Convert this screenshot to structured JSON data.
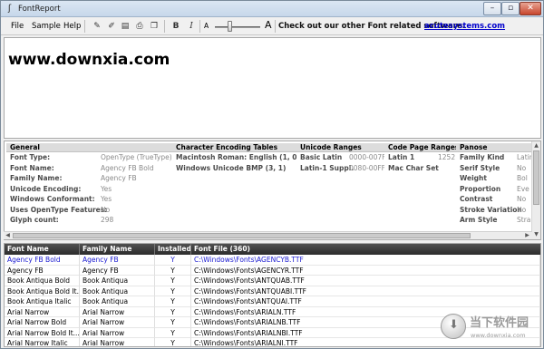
{
  "window": {
    "title": "FontReport",
    "icon": "font-app-icon"
  },
  "menu": [
    "File",
    "Sample",
    "Help"
  ],
  "toolbar": {
    "buttons": [
      {
        "name": "font-color-icon",
        "glyph": "✎"
      },
      {
        "name": "highlight-icon",
        "glyph": "✐"
      },
      {
        "name": "document-icon",
        "glyph": "▤"
      },
      {
        "name": "print-icon",
        "glyph": "⎙"
      },
      {
        "name": "copy-icon",
        "glyph": "❐"
      }
    ],
    "bold": "B",
    "italic": "I",
    "size_small": "A",
    "size_large": "A",
    "promo": "Check out our other Font related software:",
    "promo_link": "acutesystems.com"
  },
  "preview": {
    "text": "www.downxia.com"
  },
  "info": {
    "general": {
      "header": "General",
      "rows": [
        {
          "label": "Font Type:",
          "value": "OpenType (TrueType)"
        },
        {
          "label": "Font Name:",
          "value": "Agency FB Bold"
        },
        {
          "label": "Family Name:",
          "value": "Agency FB"
        },
        {
          "label": "Unicode Encoding:",
          "value": "Yes"
        },
        {
          "label": "Windows Conformant:",
          "value": "Yes"
        },
        {
          "label": "Uses OpenType Features:",
          "value": "No"
        },
        {
          "label": "Glyph count:",
          "value": "298"
        }
      ]
    },
    "encoding": {
      "header": "Character Encoding Tables",
      "rows": [
        {
          "label": "Macintosh Roman: English (1, 0, 0)"
        },
        {
          "label": "Windows Unicode BMP (3, 1)"
        }
      ]
    },
    "unicode": {
      "header": "Unicode Ranges",
      "rows": [
        {
          "label": "Basic Latin",
          "value": "0000-007F"
        },
        {
          "label": "Latin-1 Suppl.",
          "value": "0080-00FF"
        }
      ]
    },
    "codepage": {
      "header": "Code Page Ranges",
      "rows": [
        {
          "label": "Latin 1",
          "value": "1252"
        },
        {
          "label": "Mac Char Set",
          "value": ""
        }
      ]
    },
    "panose": {
      "header": "Panose",
      "rows": [
        {
          "label": "Family Kind",
          "value": "Latin"
        },
        {
          "label": "Serif Style",
          "value": "No"
        },
        {
          "label": "Weight",
          "value": "Bol"
        },
        {
          "label": "Proportion",
          "value": "Eve"
        },
        {
          "label": "Contrast",
          "value": "No"
        },
        {
          "label": "Stroke Variation",
          "value": "No"
        },
        {
          "label": "Arm Style",
          "value": "Stra"
        }
      ]
    }
  },
  "list": {
    "columns": [
      "Font Name",
      "Family Name",
      "Installed",
      "Font File (360)"
    ],
    "rows": [
      {
        "font": "Agency FB Bold",
        "family": "Agency FB",
        "installed": "Y",
        "file": "C:\\Windows\\Fonts\\AGENCYB.TTF",
        "selected": true
      },
      {
        "font": "Agency FB",
        "family": "Agency FB",
        "installed": "Y",
        "file": "C:\\Windows\\Fonts\\AGENCYR.TTF"
      },
      {
        "font": "Book Antiqua Bold",
        "family": "Book Antiqua",
        "installed": "Y",
        "file": "C:\\Windows\\Fonts\\ANTQUAB.TTF"
      },
      {
        "font": "Book Antiqua Bold It...",
        "family": "Book Antiqua",
        "installed": "Y",
        "file": "C:\\Windows\\Fonts\\ANTQUABI.TTF"
      },
      {
        "font": "Book Antiqua Italic",
        "family": "Book Antiqua",
        "installed": "Y",
        "file": "C:\\Windows\\Fonts\\ANTQUAI.TTF"
      },
      {
        "font": "Arial Narrow",
        "family": "Arial Narrow",
        "installed": "Y",
        "file": "C:\\Windows\\Fonts\\ARIALN.TTF"
      },
      {
        "font": "Arial Narrow Bold",
        "family": "Arial Narrow",
        "installed": "Y",
        "file": "C:\\Windows\\Fonts\\ARIALNB.TTF"
      },
      {
        "font": "Arial Narrow Bold It...",
        "family": "Arial Narrow",
        "installed": "Y",
        "file": "C:\\Windows\\Fonts\\ARIALNBI.TTF"
      },
      {
        "font": "Arial Narrow Italic",
        "family": "Arial Narrow",
        "installed": "Y",
        "file": "C:\\Windows\\Fonts\\ARIALNI.TTF"
      }
    ]
  },
  "watermark": {
    "text": "当下软件园",
    "sub": "www.downxia.com"
  },
  "colors": {
    "selected_row_text": "#1a1ad0",
    "link": "#0000cc",
    "list_header_bg": "#3a3a3a"
  }
}
